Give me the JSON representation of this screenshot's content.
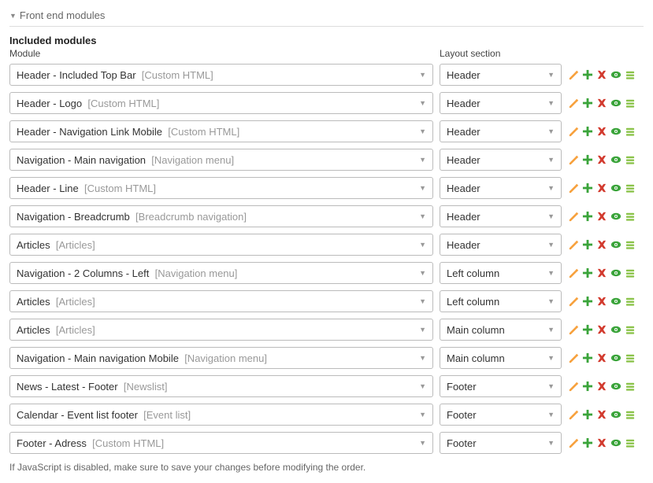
{
  "panel": {
    "title": "Front end modules"
  },
  "subtitle": "Included modules",
  "columns": {
    "module": "Module",
    "layout": "Layout section"
  },
  "footer_note": "If JavaScript is disabled, make sure to save your changes before modifying the order.",
  "icons": {
    "edit": "edit",
    "add": "add",
    "delete": "delete",
    "toggle": "toggle",
    "drag": "drag"
  },
  "rows": [
    {
      "module_name": "Header - Included Top Bar",
      "module_type": "[Custom HTML]",
      "layout": "Header",
      "edit_enabled": true
    },
    {
      "module_name": "Header - Logo",
      "module_type": "[Custom HTML]",
      "layout": "Header",
      "edit_enabled": true
    },
    {
      "module_name": "Header - Navigation Link Mobile",
      "module_type": "[Custom HTML]",
      "layout": "Header",
      "edit_enabled": true
    },
    {
      "module_name": "Navigation - Main navigation",
      "module_type": "[Navigation menu]",
      "layout": "Header",
      "edit_enabled": true
    },
    {
      "module_name": "Header - Line",
      "module_type": "[Custom HTML]",
      "layout": "Header",
      "edit_enabled": true
    },
    {
      "module_name": "Navigation - Breadcrumb",
      "module_type": "[Breadcrumb navigation]",
      "layout": "Header",
      "edit_enabled": true
    },
    {
      "module_name": "Articles",
      "module_type": "[Articles]",
      "layout": "Header",
      "edit_enabled": false
    },
    {
      "module_name": "Navigation - 2 Columns - Left",
      "module_type": "[Navigation menu]",
      "layout": "Left column",
      "edit_enabled": true
    },
    {
      "module_name": "Articles",
      "module_type": "[Articles]",
      "layout": "Left column",
      "edit_enabled": false
    },
    {
      "module_name": "Articles",
      "module_type": "[Articles]",
      "layout": "Main column",
      "edit_enabled": false
    },
    {
      "module_name": "Navigation - Main navigation Mobile",
      "module_type": "[Navigation menu]",
      "layout": "Main column",
      "edit_enabled": true
    },
    {
      "module_name": "News - Latest - Footer",
      "module_type": "[Newslist]",
      "layout": "Footer",
      "edit_enabled": true
    },
    {
      "module_name": "Calendar - Event list footer",
      "module_type": "[Event list]",
      "layout": "Footer",
      "edit_enabled": true
    },
    {
      "module_name": "Footer - Adress",
      "module_type": "[Custom HTML]",
      "layout": "Footer",
      "edit_enabled": true
    }
  ]
}
